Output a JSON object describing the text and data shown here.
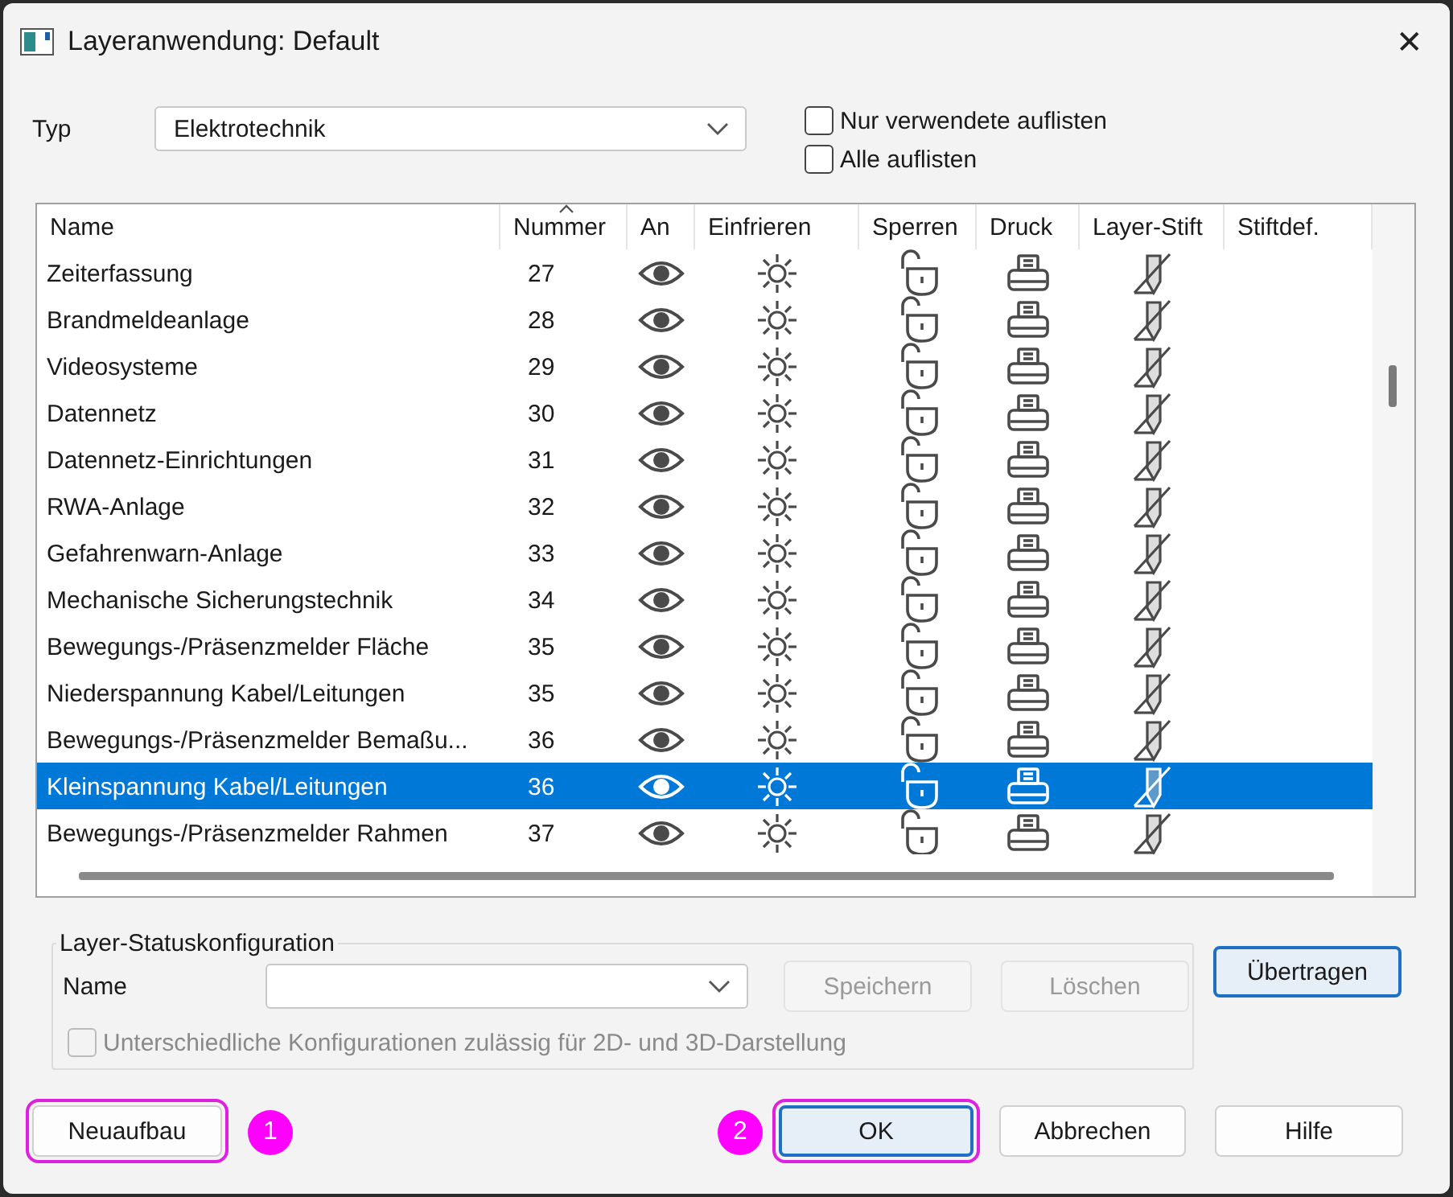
{
  "window": {
    "title": "Layeranwendung: Default",
    "close": "✕"
  },
  "typ": {
    "label": "Typ",
    "value": "Elektrotechnik"
  },
  "filters": [
    {
      "label": "Nur verwendete auflisten",
      "checked": false
    },
    {
      "label": "Alle auflisten",
      "checked": false
    }
  ],
  "table": {
    "columns": [
      {
        "label": "Name",
        "sorted": false
      },
      {
        "label": "Nummer",
        "sorted": true
      },
      {
        "label": "An",
        "sorted": false
      },
      {
        "label": "Einfrieren",
        "sorted": false
      },
      {
        "label": "Sperren",
        "sorted": false
      },
      {
        "label": "Druck",
        "sorted": false
      },
      {
        "label": "Layer-Stift",
        "sorted": false
      },
      {
        "label": "Stiftdef.",
        "sorted": false
      }
    ],
    "rows": [
      {
        "name": "Zeiterfassung",
        "number": "27",
        "on": true,
        "frozen": false,
        "locked": false,
        "print": true,
        "selected": false
      },
      {
        "name": "Brandmeldeanlage",
        "number": "28",
        "on": true,
        "frozen": false,
        "locked": false,
        "print": true,
        "selected": false
      },
      {
        "name": "Videosysteme",
        "number": "29",
        "on": true,
        "frozen": false,
        "locked": false,
        "print": true,
        "selected": false
      },
      {
        "name": "Datennetz",
        "number": "30",
        "on": true,
        "frozen": false,
        "locked": false,
        "print": true,
        "selected": false
      },
      {
        "name": "Datennetz-Einrichtungen",
        "number": "31",
        "on": true,
        "frozen": false,
        "locked": false,
        "print": true,
        "selected": false
      },
      {
        "name": "RWA-Anlage",
        "number": "32",
        "on": true,
        "frozen": false,
        "locked": false,
        "print": true,
        "selected": false
      },
      {
        "name": "Gefahrenwarn-Anlage",
        "number": "33",
        "on": true,
        "frozen": false,
        "locked": false,
        "print": true,
        "selected": false
      },
      {
        "name": "Mechanische Sicherungstechnik",
        "number": "34",
        "on": true,
        "frozen": false,
        "locked": false,
        "print": true,
        "selected": false
      },
      {
        "name": "Bewegungs-/Präsenzmelder Fläche",
        "number": "35",
        "on": true,
        "frozen": false,
        "locked": false,
        "print": true,
        "selected": false
      },
      {
        "name": "Niederspannung Kabel/Leitungen",
        "number": "35",
        "on": true,
        "frozen": false,
        "locked": false,
        "print": true,
        "selected": false
      },
      {
        "name": "Bewegungs-/Präsenzmelder Bemaßu...",
        "number": "36",
        "on": true,
        "frozen": false,
        "locked": false,
        "print": true,
        "selected": false
      },
      {
        "name": "Kleinspannung Kabel/Leitungen",
        "number": "36",
        "on": true,
        "frozen": false,
        "locked": false,
        "print": true,
        "selected": true
      },
      {
        "name": "Bewegungs-/Präsenzmelder Rahmen",
        "number": "37",
        "on": true,
        "frozen": false,
        "locked": false,
        "print": true,
        "selected": false
      }
    ]
  },
  "config": {
    "title": "Layer-Statuskonfiguration",
    "name_label": "Name",
    "buttons": [
      {
        "label": "Speichern",
        "disabled": true
      },
      {
        "label": "Löschen",
        "disabled": true
      }
    ],
    "option": {
      "label": "Unterschiedliche Konfigurationen zulässig für 2D- und 3D-Darstellung",
      "checked": false,
      "disabled": true
    }
  },
  "transfer_button": {
    "label": "Übertragen",
    "default": true
  },
  "buttons": [
    {
      "label": "Neuaufbau",
      "highlighted": true,
      "badge": "1",
      "default": false
    },
    {
      "label": "OK",
      "highlighted": true,
      "badge": "2",
      "default": true
    },
    {
      "label": "Abbrechen",
      "highlighted": false,
      "default": false
    },
    {
      "label": "Hilfe",
      "highlighted": false,
      "default": false
    }
  ]
}
